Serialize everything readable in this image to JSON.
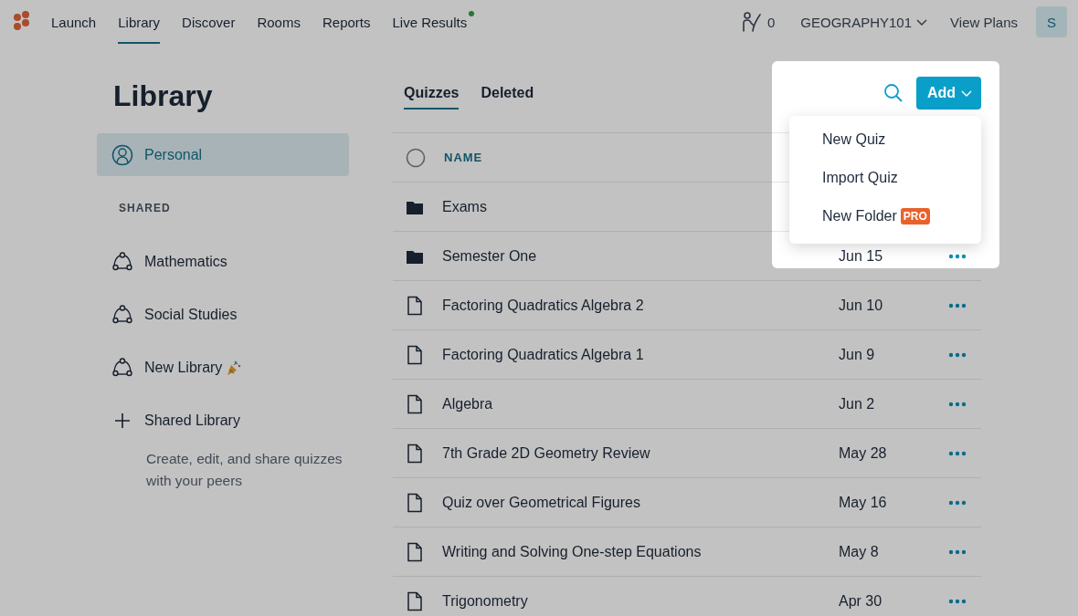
{
  "nav": {
    "items": [
      {
        "label": "Launch",
        "selected": false,
        "indicator": false
      },
      {
        "label": "Library",
        "selected": true,
        "indicator": false
      },
      {
        "label": "Discover",
        "selected": false,
        "indicator": false
      },
      {
        "label": "Rooms",
        "selected": false,
        "indicator": false
      },
      {
        "label": "Reports",
        "selected": false,
        "indicator": false
      },
      {
        "label": "Live Results",
        "selected": false,
        "indicator": true
      }
    ]
  },
  "account": {
    "count": "0",
    "class_name": "GEOGRAPHY101",
    "plans": "View Plans",
    "avatar": "S"
  },
  "sidebar": {
    "title": "Library",
    "items": [
      {
        "label": "Personal",
        "selected": true
      }
    ],
    "section": "SHARED",
    "shared": [
      {
        "label": "Mathematics",
        "celebrate": false
      },
      {
        "label": "Social Studies",
        "celebrate": false
      },
      {
        "label": "New Library",
        "celebrate": true
      }
    ],
    "add": {
      "label": "Shared Library",
      "hint": "Create, edit, and share quizzes with your peers"
    }
  },
  "main": {
    "tabs": [
      {
        "label": "Quizzes",
        "selected": true
      },
      {
        "label": "Deleted",
        "selected": false
      }
    ],
    "add_button": "Add",
    "table": {
      "select_all": {
        "checked": false
      },
      "columns": [
        "NAME"
      ],
      "rows": [
        {
          "kind": "folder",
          "name": "Exams"
        },
        {
          "kind": "folder",
          "name": "Semester One",
          "date": "Jun 15",
          "more": true
        },
        {
          "kind": "file",
          "name": "Factoring Quadratics Algebra 2",
          "date": "Jun 10",
          "more": true
        },
        {
          "kind": "file",
          "name": "Factoring Quadratics Algebra 1",
          "date": "Jun 9",
          "more": true
        },
        {
          "kind": "file",
          "name": "Algebra",
          "date": "Jun 2",
          "more": true
        },
        {
          "kind": "file",
          "name": "7th Grade 2D Geometry Review",
          "date": "May 28",
          "more": true
        },
        {
          "kind": "file",
          "name": "Quiz over Geometrical Figures",
          "date": "May 16",
          "more": true
        },
        {
          "kind": "file",
          "name": "Writing and Solving One-step Equations",
          "date": "May 8",
          "more": true
        },
        {
          "kind": "file",
          "name": "Trigonometry",
          "date": "Apr 30",
          "more": true
        }
      ]
    }
  },
  "add_menu": {
    "items": [
      {
        "label": "New Quiz"
      },
      {
        "label": "Import Quiz"
      },
      {
        "label": "New Folder",
        "badge": "PRO"
      }
    ]
  }
}
